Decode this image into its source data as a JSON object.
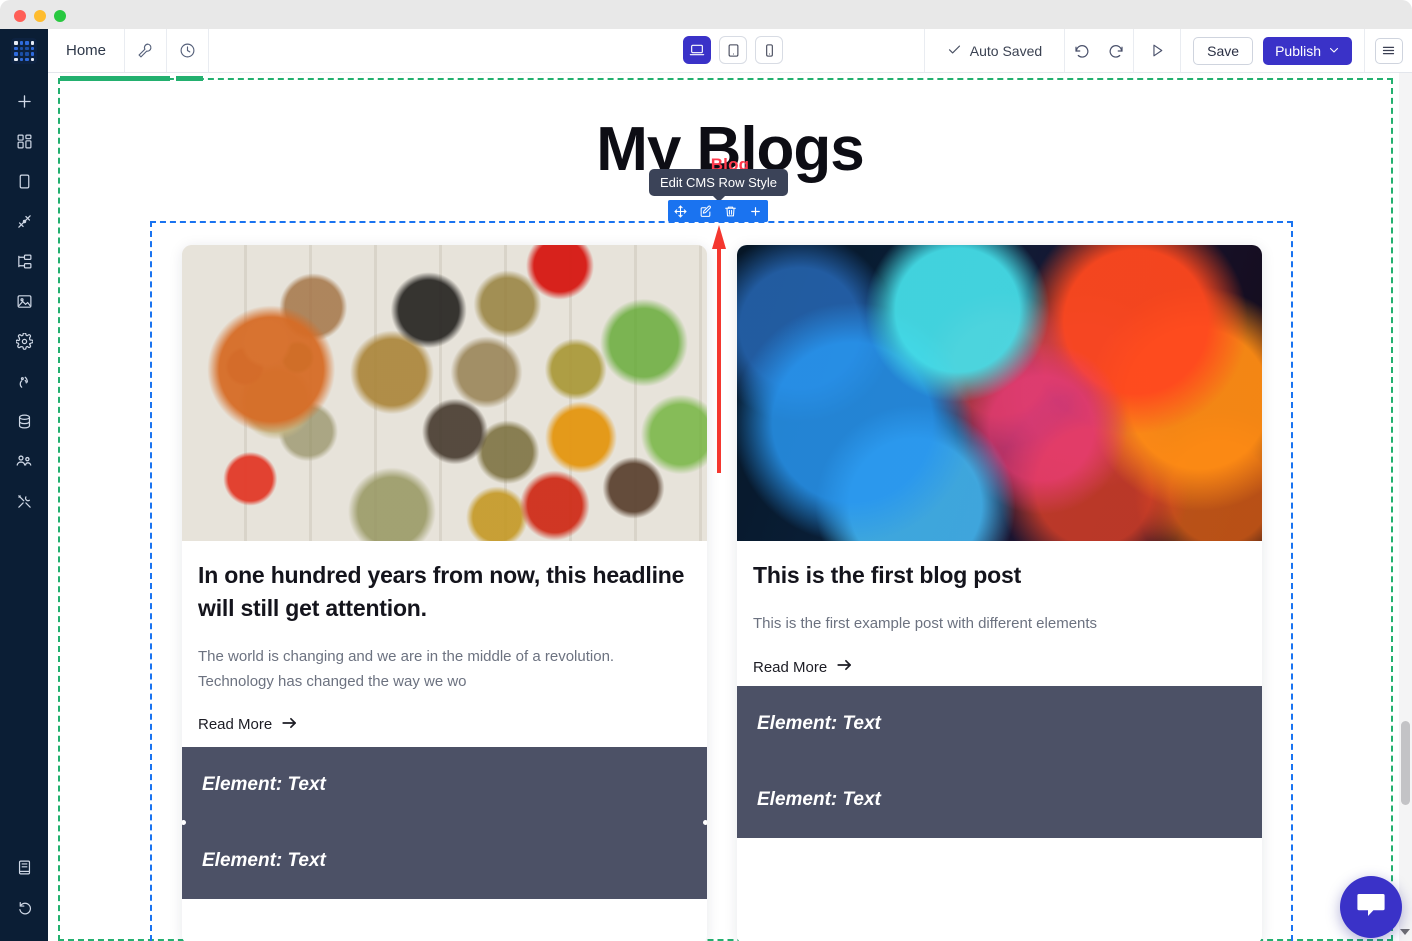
{
  "window": {
    "traffic_lights": [
      "close",
      "minimize",
      "maximize"
    ]
  },
  "toolbar": {
    "home_label": "Home",
    "wrench_icon": "wrench-icon",
    "history_icon": "clock-history-icon",
    "devices": [
      {
        "name": "desktop",
        "icon": "desktop-icon",
        "active": true
      },
      {
        "name": "tablet",
        "icon": "tablet-icon",
        "active": false
      },
      {
        "name": "mobile",
        "icon": "mobile-icon",
        "active": false
      }
    ],
    "autosave_label": "Auto Saved",
    "autosave_icon": "check-icon",
    "undo_icon": "undo-icon",
    "redo_icon": "redo-icon",
    "preview_icon": "play-preview-icon",
    "save_label": "Save",
    "publish_label": "Publish",
    "publish_chevron": "chevron-down-icon",
    "menu_icon": "hamburger-menu-icon"
  },
  "sidebar": {
    "logo": "app-logo-grid",
    "items": [
      {
        "name": "add",
        "icon": "plus-icon"
      },
      {
        "name": "widgets",
        "icon": "grid-widgets-icon"
      },
      {
        "name": "pages",
        "icon": "page-icon"
      },
      {
        "name": "design",
        "icon": "brush-icon"
      },
      {
        "name": "structure",
        "icon": "sitemap-icon"
      },
      {
        "name": "media",
        "icon": "image-icon"
      },
      {
        "name": "settings",
        "icon": "gear-icon"
      },
      {
        "name": "integrations",
        "icon": "signal-icon"
      },
      {
        "name": "database",
        "icon": "database-icon"
      },
      {
        "name": "team",
        "icon": "users-icon"
      },
      {
        "name": "tools",
        "icon": "tools-icon"
      }
    ],
    "bottom_items": [
      {
        "name": "docs",
        "icon": "book-icon"
      },
      {
        "name": "revisions",
        "icon": "revision-arrow-icon"
      }
    ]
  },
  "canvas": {
    "kicker": "Blog",
    "heading": "My Blogs",
    "row_tooltip": "Edit CMS Row Style",
    "row_toolbar": [
      {
        "name": "move",
        "icon": "move-arrows-icon"
      },
      {
        "name": "edit",
        "icon": "pencil-edit-icon"
      },
      {
        "name": "delete",
        "icon": "trash-icon"
      },
      {
        "name": "add",
        "icon": "plus-icon"
      }
    ],
    "annotation": {
      "name": "red-up-arrow",
      "color": "#f4372f"
    },
    "cards": [
      {
        "image": "spices-flatlay-photo",
        "title": "In one hundred years from now, this headline will still get attention.",
        "excerpt": "The world is changing and we are in the middle of a revolution. Technology has changed the way we wo",
        "read_more": "Read More",
        "read_more_icon": "arrow-right-icon",
        "overlay_items": [
          "Element: Text",
          "Element: Text"
        ]
      },
      {
        "image": "colored-ink-in-water-photo",
        "title": "This is the first blog post",
        "excerpt": "This is the first example post with different elements",
        "read_more": "Read More",
        "read_more_icon": "arrow-right-icon",
        "overlay_items": [
          "Element: Text",
          "Element: Text"
        ]
      }
    ]
  },
  "chat": {
    "icon": "chat-bubble-icon"
  },
  "colors": {
    "accent_publish": "#3a32c8",
    "row_toolbar_blue": "#1a73f0",
    "section_green": "#23b06f",
    "kicker_red": "#ff3b4e",
    "overlay_slate": "#4c5166",
    "sidebar_navy": "#0b1e35"
  }
}
